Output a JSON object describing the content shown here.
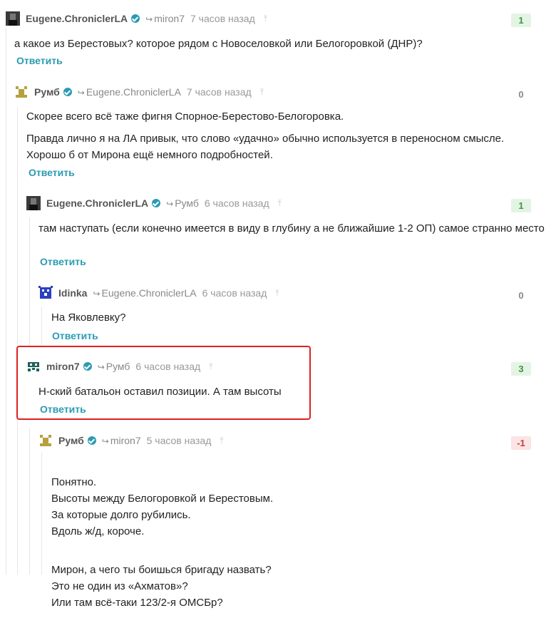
{
  "comments": [
    {
      "author": "Eugene.ChroniclerLA",
      "reply_to": "miron7",
      "time": "7 часов назад",
      "score": "1",
      "text": [
        "а какое из Берестовых? которое рядом с Новоселовкой или Белогоровкой (ДНР)?"
      ],
      "reply": "Ответить"
    },
    {
      "author": "Румб",
      "reply_to": "Eugene.ChroniclerLA",
      "time": "7 часов назад",
      "score": "0",
      "text": [
        "Скорее всего всё таже фигня Спорное-Берестово-Белогоровка.",
        "Правда лично я на ЛА привык, что слово «удачно» обычно используется в переносном смысле. Хорошо б от Мирона ещё немного подробностей."
      ],
      "reply": "Ответить"
    },
    {
      "author": "Eugene.ChroniclerLA",
      "reply_to": "Румб",
      "time": "6 часов назад",
      "score": "1",
      "text": [
        "там наступать (если конечно имеется в виду в глубину а не ближайшие 1-2 ОП) самое странно место"
      ],
      "reply": "Ответить"
    },
    {
      "author": "Idinka",
      "reply_to": "Eugene.ChroniclerLA",
      "time": "6 часов назад",
      "score": "0",
      "text": [
        "На Яковлевку?"
      ],
      "reply": "Ответить"
    },
    {
      "author": "miron7",
      "reply_to": "Румб",
      "time": "6 часов назад",
      "score": "3",
      "text": [
        "Н-ский батальон оставил позиции. А там высоты"
      ],
      "reply": "Ответить"
    },
    {
      "author": "Румб",
      "reply_to": "miron7",
      "time": "5 часов назад",
      "score": "-1",
      "text": [
        "Понятно.\nВысоты между Белогоровкой и Берестовым.\nЗа которые долго рубились.\nВдоль ж/д, короче.",
        "Мирон, а чего ты боишься бригаду назвать?\nЭто не один из «Ахматов»?\nИли там всё-таки 123/2-я ОМСБр?"
      ],
      "reply": ""
    }
  ],
  "colors": {
    "accent": "#2a9bb3",
    "positive": "#3a9a3a",
    "negative": "#c83b3b",
    "highlight": "#e02020"
  }
}
